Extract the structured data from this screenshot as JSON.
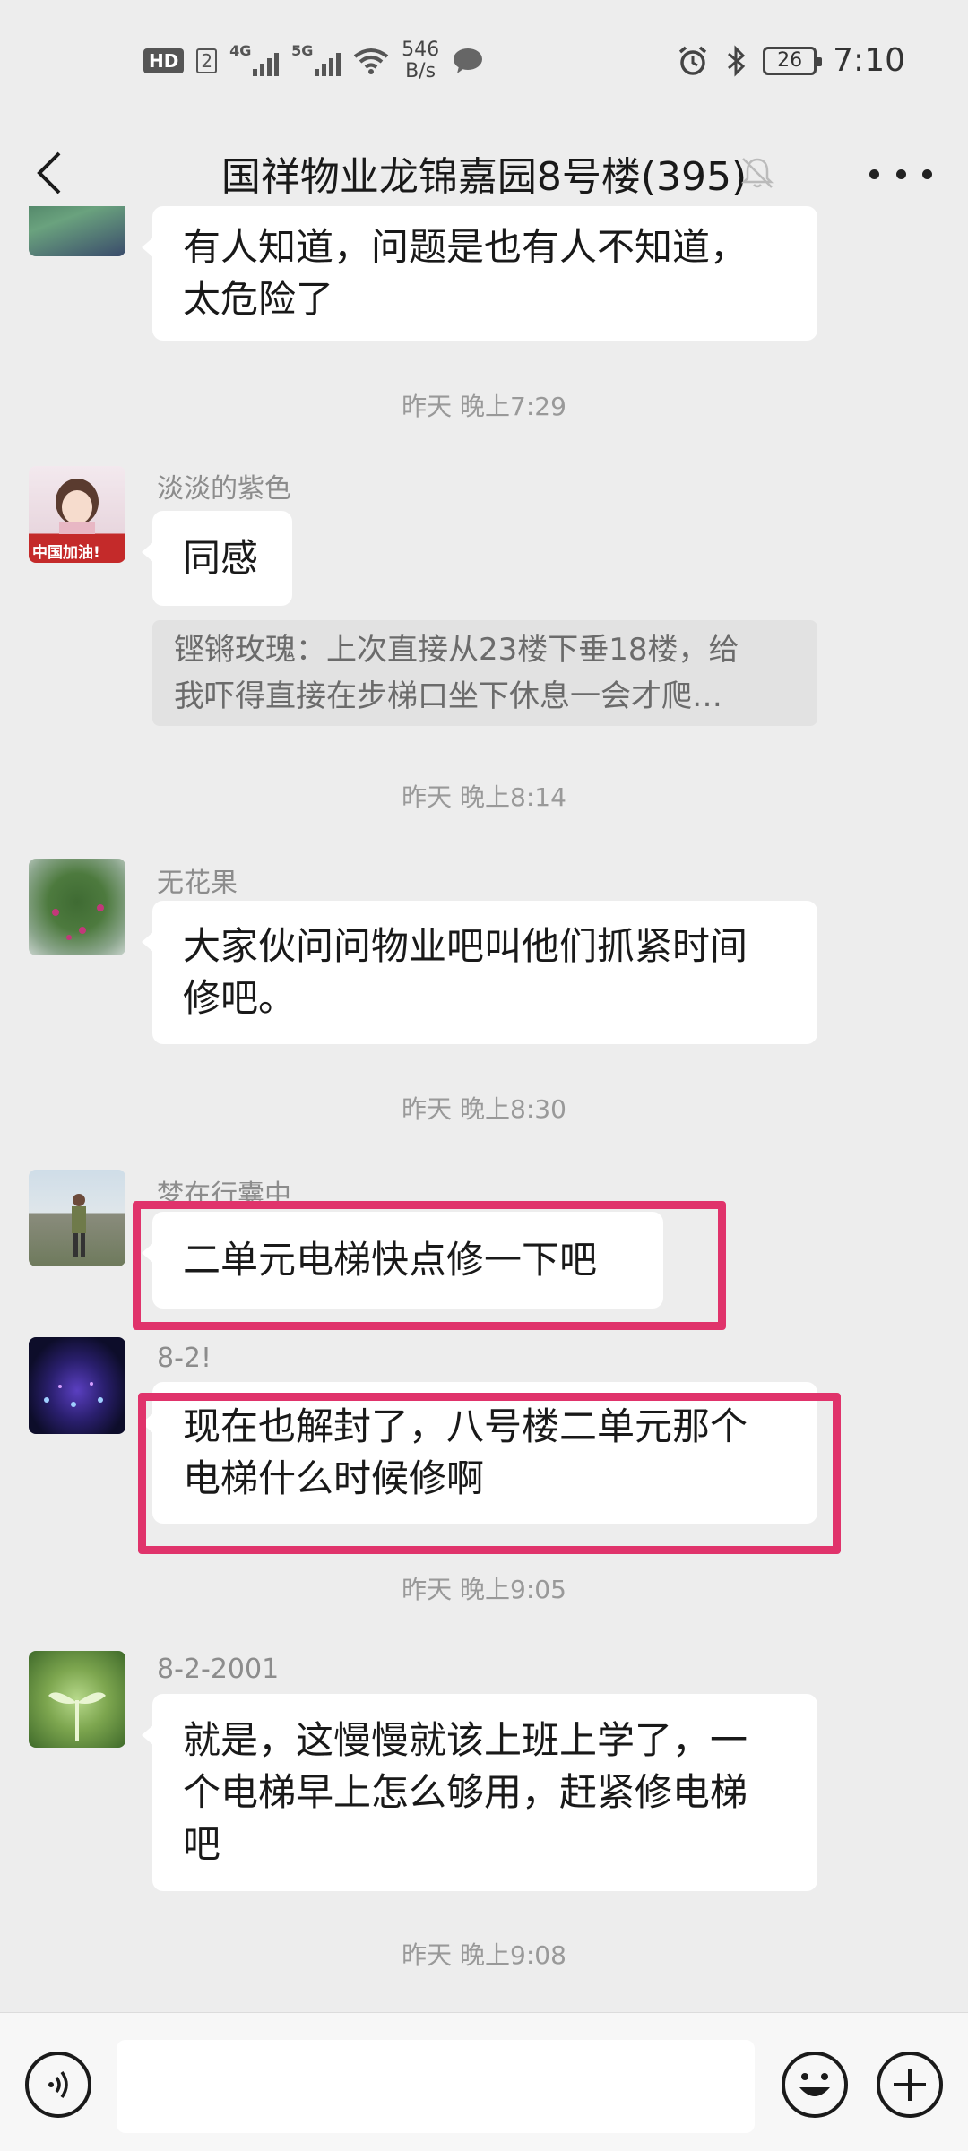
{
  "status_bar": {
    "hd_label": "HD",
    "sim_label": "2",
    "network_1": "4G",
    "network_2": "5G",
    "net_speed_value": "546",
    "net_speed_unit": "B/s",
    "battery_level": "26",
    "time": "7:10"
  },
  "header": {
    "title": "国祥物业龙锦嘉园8号楼(395)"
  },
  "messages": [
    {
      "text_line1": "有人知道，问题是也有人不知道，",
      "text_line2": "太危险了"
    },
    {
      "timestamp": "昨天 晚上7:29"
    },
    {
      "sender": "淡淡的紫色",
      "avatar_badge": "中国加油!",
      "text": "同感",
      "quote_line1": "铿锵玫瑰：上次直接从23楼下垂18楼，给",
      "quote_line2": "我吓得直接在步梯口坐下休息一会才爬…"
    },
    {
      "timestamp": "昨天 晚上8:14"
    },
    {
      "sender": "无花果",
      "text_line1": "大家伙问问物业吧叫他们抓紧时间",
      "text_line2": "修吧。"
    },
    {
      "timestamp": "昨天 晚上8:30"
    },
    {
      "sender": "梦在行囊中",
      "text": "二单元电梯快点修一下吧"
    },
    {
      "sender": "8-2!",
      "text_line1": "现在也解封了，八号楼二单元那个",
      "text_line2": "电梯什么时候修啊"
    },
    {
      "timestamp": "昨天 晚上9:05"
    },
    {
      "sender": "8-2-2001",
      "text_line1": "就是，这慢慢就该上班上学了，一",
      "text_line2": "个电梯早上怎么够用，赶紧修电梯",
      "text_line3": "吧"
    },
    {
      "timestamp": "昨天 晚上9:08"
    }
  ],
  "colors": {
    "background": "#ededed",
    "bubble": "#ffffff",
    "highlight": "#e0336b",
    "timestamp": "#999999"
  },
  "icons": [
    "back-icon",
    "mute-bell-icon",
    "more-icon",
    "voice-icon",
    "emoji-icon",
    "plus-icon",
    "alarm-icon",
    "bluetooth-icon",
    "wifi-icon",
    "message-icon"
  ]
}
